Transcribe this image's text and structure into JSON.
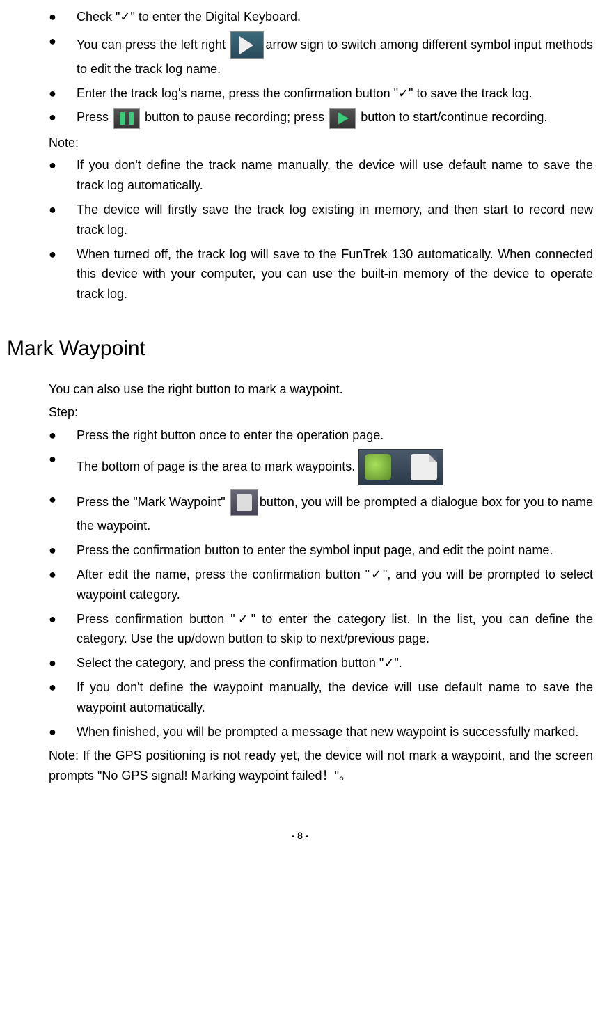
{
  "section1": {
    "bullets": [
      {
        "pre": "Check \"",
        "check": "✓",
        "post": "\" to enter the Digital Keyboard."
      },
      {
        "pre": "You can press the left right ",
        "icon": "arrow-right",
        "post": "arrow sign to switch among different symbol input methods to edit the track log name."
      },
      {
        "pre": "Enter the track log's name, press the confirmation button \"",
        "check": "✓",
        "post": "\" to save the track log."
      },
      {
        "pre": "Press ",
        "icon1": "pause",
        "mid": " button to pause recording; press ",
        "icon2": "play",
        "post": " button to start/continue recording."
      }
    ],
    "note_label": "Note:",
    "note_bullets": [
      "If you don't define the track name manually, the device will use default name to save the track log automatically.",
      "The device will firstly save the track log existing in memory, and then start to record new track log.",
      "When turned off, the track log will save to the FunTrek 130 automatically. When connected this device with your computer, you can use the built-in memory of the device to operate track log."
    ]
  },
  "heading": "Mark Waypoint",
  "section2": {
    "intro1": "You can also use the right button to mark a waypoint.",
    "intro2": "Step:",
    "bullets": [
      {
        "text": "Press the right button once to enter the operation page."
      },
      {
        "pre": "The bottom of page is the area to mark waypoints. ",
        "strip": true
      },
      {
        "pre": "Press the \"Mark Waypoint\" ",
        "icon": "mark",
        "post": "button, you will be prompted a dialogue box for you to name the waypoint."
      },
      {
        "text": "Press the confirmation button to enter the symbol input page, and edit the point name."
      },
      {
        "pre": "After edit the name, press the confirmation button \"",
        "check": "✓",
        "post": "\", and you will be prompted to select waypoint category."
      },
      {
        "pre": "Press confirmation button \"",
        "check": "✓",
        "post": "\" to enter the category list. In the list, you can define the category. Use the up/down button to skip to next/previous page."
      },
      {
        "pre": "Select the category, and press the confirmation button \"",
        "check": "✓",
        "post": "\"."
      },
      {
        "text": "If you don't define the waypoint manually, the device will use default name to save the waypoint automatically."
      },
      {
        "text": "When finished, you will be prompted a message that new waypoint is successfully marked."
      }
    ],
    "closing_note": "Note: If the GPS positioning is not ready yet, the device will not mark a waypoint, and the screen prompts \"No GPS signal! Marking waypoint failed！\"。"
  },
  "page_number": "- 8 -"
}
